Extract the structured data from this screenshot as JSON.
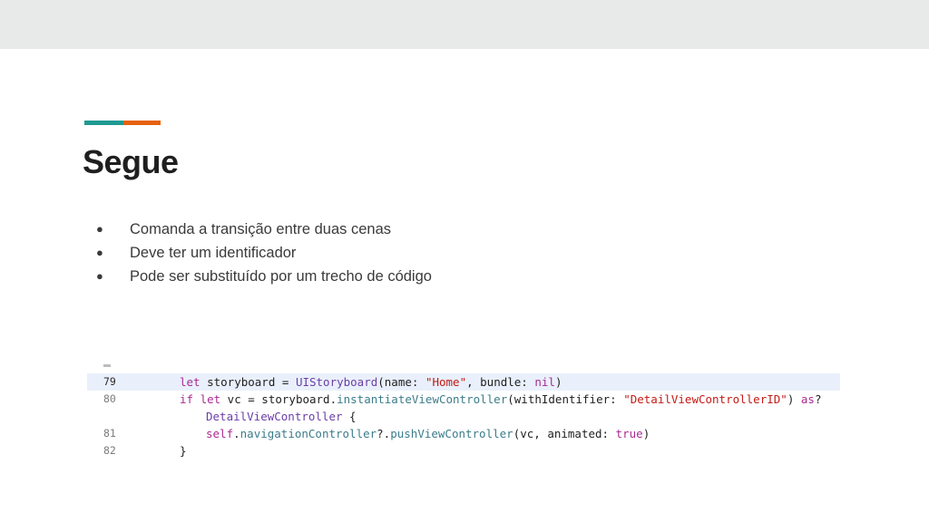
{
  "slide": {
    "title": "Segue",
    "accent_colors": [
      "#1e9a93",
      "#e6620e"
    ],
    "bullet_glyph": "●",
    "bullets": [
      "Comanda a transição entre duas cenas",
      "Deve ter um identificador",
      "Pode ser substituído por um trecho de código"
    ]
  },
  "code": {
    "lines": [
      {
        "num": "79",
        "t": [
          "let",
          " storyboard = ",
          "UIStoryboard",
          "(name: ",
          "\"Home\"",
          ", bundle: ",
          "nil",
          ")"
        ]
      },
      {
        "num": "80",
        "t": [
          "if let",
          " vc = storyboard.",
          "instantiateViewController",
          "(withIdentifier: ",
          "\"DetailViewControllerID\"",
          ") ",
          "as",
          "?"
        ]
      },
      {
        "num": "",
        "t": [
          "DetailViewController",
          " {"
        ]
      },
      {
        "num": "81",
        "t": [
          "self",
          ".",
          "navigationController",
          "?.",
          "pushViewController",
          "(vc, animated: ",
          "true",
          ")"
        ]
      },
      {
        "num": "82",
        "t": [
          "}"
        ]
      }
    ]
  }
}
